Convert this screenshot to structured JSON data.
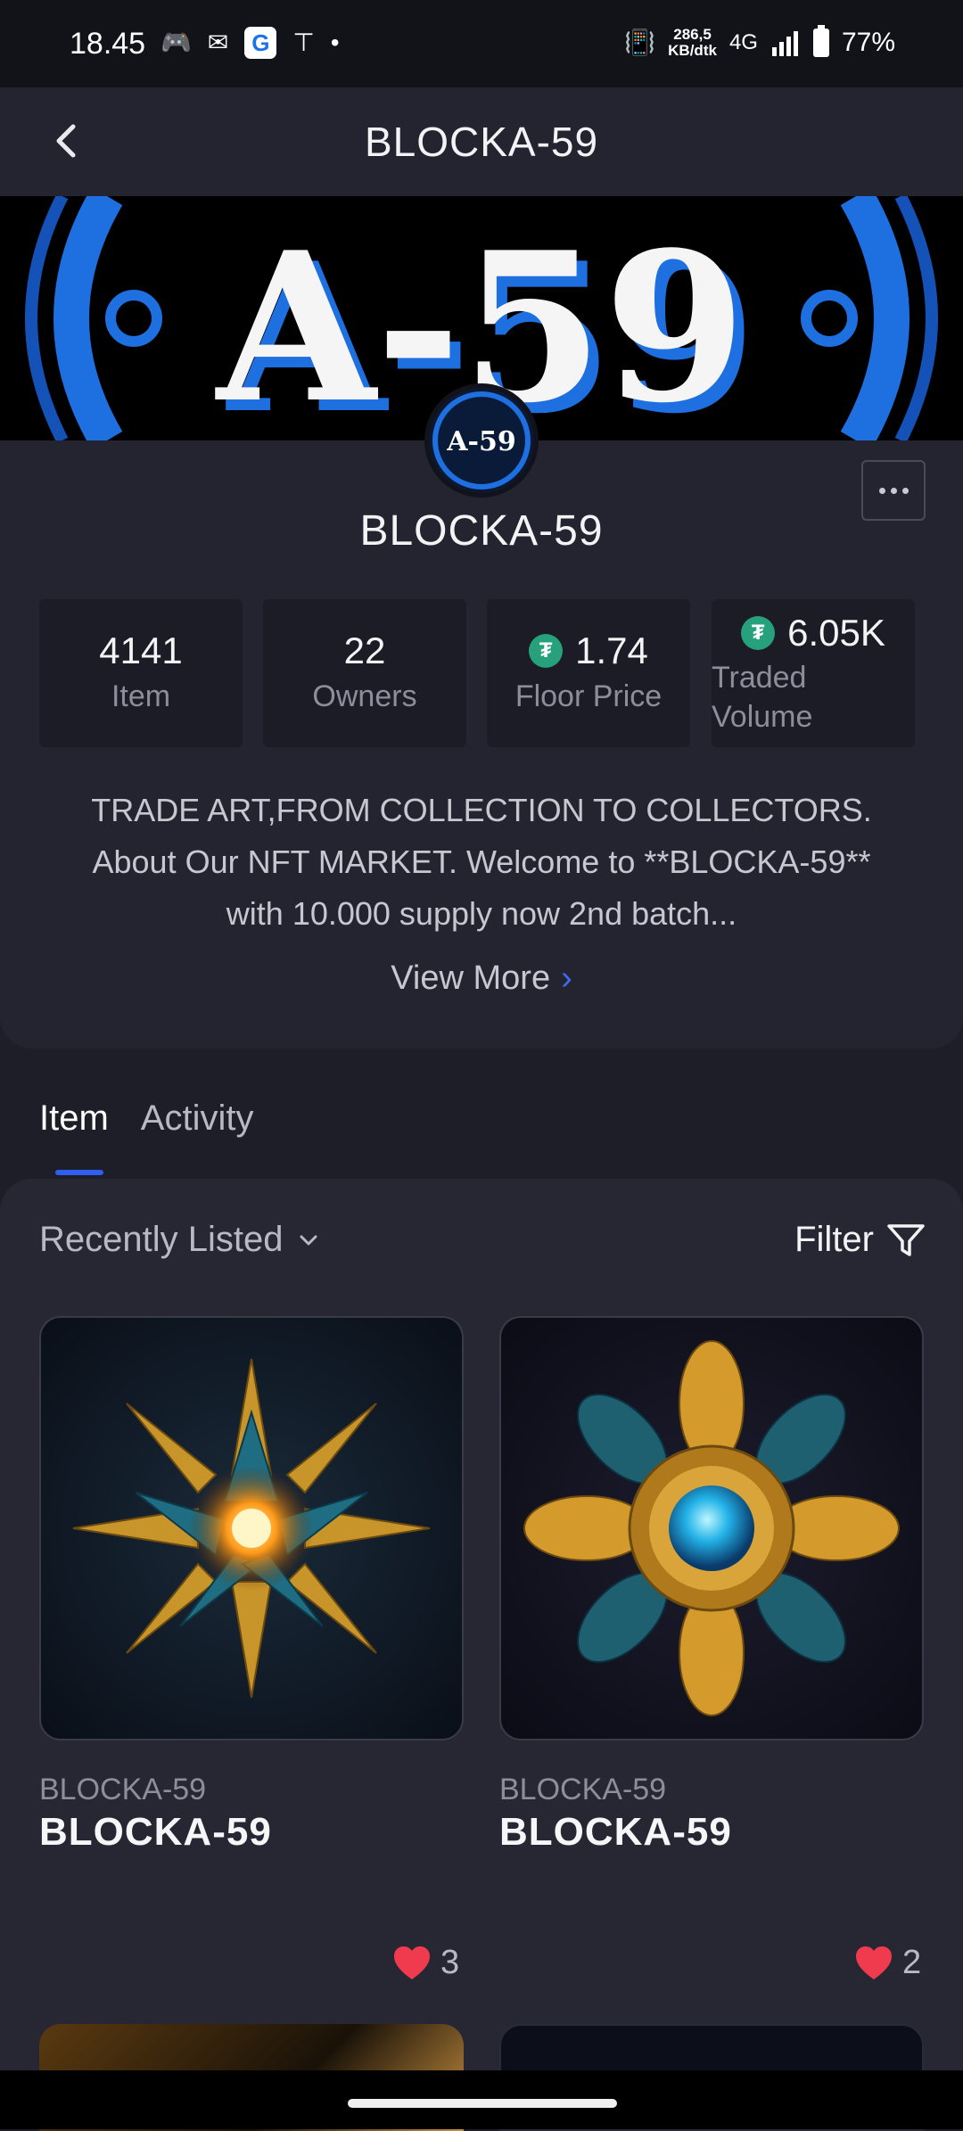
{
  "status_bar": {
    "time": "18.45",
    "speed_top": "286,5",
    "speed_bottom": "KB/dtk",
    "network": "4G",
    "battery": "77%"
  },
  "header": {
    "title": "BLOCKA-59"
  },
  "banner": {
    "text": "A-59"
  },
  "avatar": {
    "text": "A-59"
  },
  "collection": {
    "name": "BLOCKA-59",
    "stats": [
      {
        "value": "4141",
        "label": "Item"
      },
      {
        "value": "22",
        "label": "Owners"
      },
      {
        "value": "1.74",
        "label": "Floor Price"
      },
      {
        "value": "6.05K",
        "label": "Traded Volume"
      }
    ],
    "description_lines": [
      "TRADE ART,FROM COLLECTION TO COLLECTORS.",
      "About Our NFT MARKET. Welcome to **BLOCKA-59**",
      "with 10.000 supply now 2nd batch..."
    ],
    "view_more": "View More"
  },
  "tabs": [
    {
      "label": "Item"
    },
    {
      "label": "Activity"
    }
  ],
  "list": {
    "sort_label": "Recently Listed",
    "filter_label": "Filter",
    "items": [
      {
        "collection": "BLOCKA-59",
        "title": "BLOCKA-59",
        "likes": "3"
      },
      {
        "collection": "BLOCKA-59",
        "title": "BLOCKA-59",
        "likes": "2"
      }
    ]
  },
  "colors": {
    "accent": "#2f5ef0",
    "tether": "#26a17b",
    "heart": "#ef3b4d",
    "background": "#1d1e27"
  }
}
